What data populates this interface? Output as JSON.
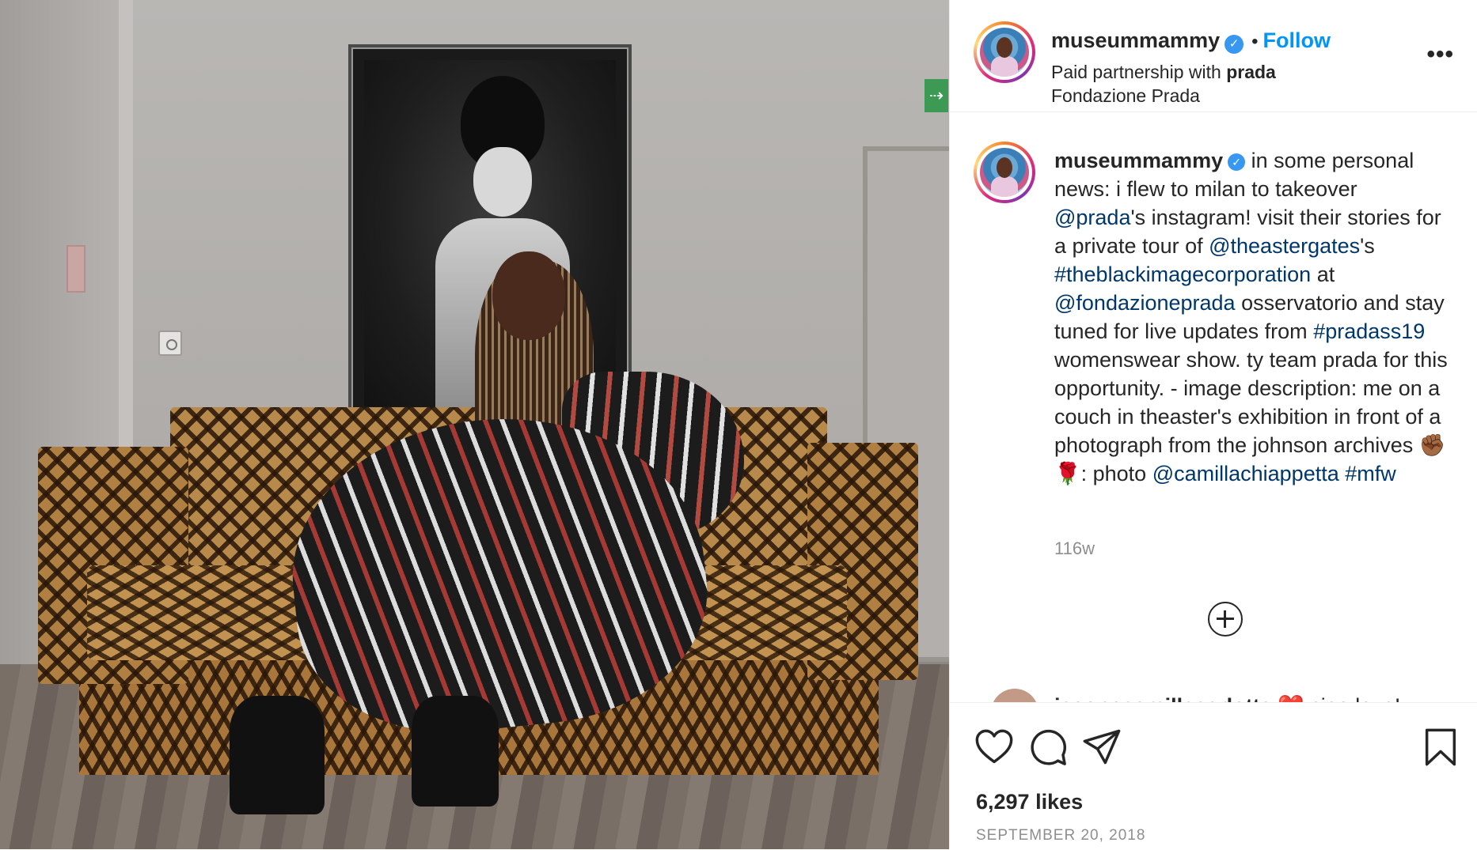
{
  "post": {
    "photo_alt": "",
    "header": {
      "username": "museummammy",
      "verified_mark": "✓",
      "separator": "•",
      "follow_label": "Follow",
      "partnership_prefix": "Paid partnership with",
      "partner": "prada",
      "location": "Fondazione Prada",
      "more_label": "•••"
    },
    "caption": {
      "username": "museummammy",
      "segments": [
        {
          "text": " in some personal news: i flew to milan to takeover ",
          "link": false
        },
        {
          "text": "@prada",
          "link": true
        },
        {
          "text": "'s instagram! visit their stories for a private tour of ",
          "link": false
        },
        {
          "text": "@theastergates",
          "link": true
        },
        {
          "text": "'s ",
          "link": false
        },
        {
          "text": "#theblackimagecorporation",
          "link": true
        },
        {
          "text": " at ",
          "link": false
        },
        {
          "text": "@fondazioneprada",
          "link": true
        },
        {
          "text": " osservatorio and stay tuned for live updates from ",
          "link": false
        },
        {
          "text": "#pradass19",
          "link": true
        },
        {
          "text": " womenswear show. ty team prada for this opportunity. - image description: me on a couch in theaster's exhibition in front of a photograph from the johnson archives ✊🏾🌹: photo ",
          "link": false
        },
        {
          "text": "@camillachiappetta",
          "link": true
        },
        {
          "text": " ",
          "link": false
        },
        {
          "text": "#mfw",
          "link": true
        }
      ],
      "age": "116w"
    },
    "next_comment": {
      "username": "jasonecamillacarlotta",
      "text": "❤️ ciao love!"
    },
    "actions": {
      "like_icon": "heart-icon",
      "comment_icon": "comment-icon",
      "share_icon": "paper-plane-icon",
      "save_icon": "bookmark-icon",
      "load_more_icon": "plus-circle-icon"
    },
    "likes": "6,297 likes",
    "date": "SEPTEMBER 20, 2018"
  },
  "colors": {
    "link": "#00376b",
    "follow": "#0095f6",
    "verified": "#3897f0",
    "muted": "#8e8e8e",
    "text": "#262626"
  }
}
